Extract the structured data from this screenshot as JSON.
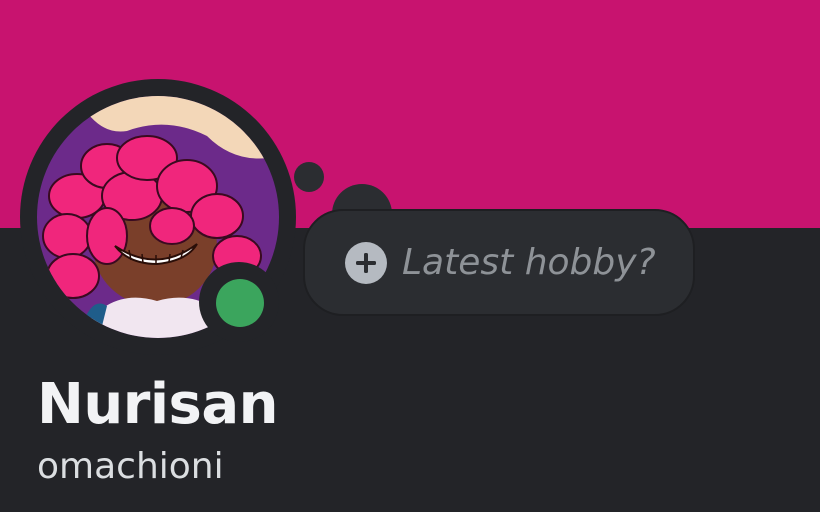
{
  "profile": {
    "display_name": "Nurisan",
    "username": "omachioni",
    "presence": "online",
    "custom_status_placeholder": "Latest hobby?"
  },
  "icons": {
    "add_status": "plus-icon",
    "presence": "online-status-icon",
    "avatar": "avatar-image"
  },
  "colors": {
    "banner": "#c8136f",
    "background": "#232428",
    "bubble": "#2b2d31",
    "online": "#3ba55d",
    "hair": "#f0267c",
    "skin": "#7a3f2a"
  }
}
